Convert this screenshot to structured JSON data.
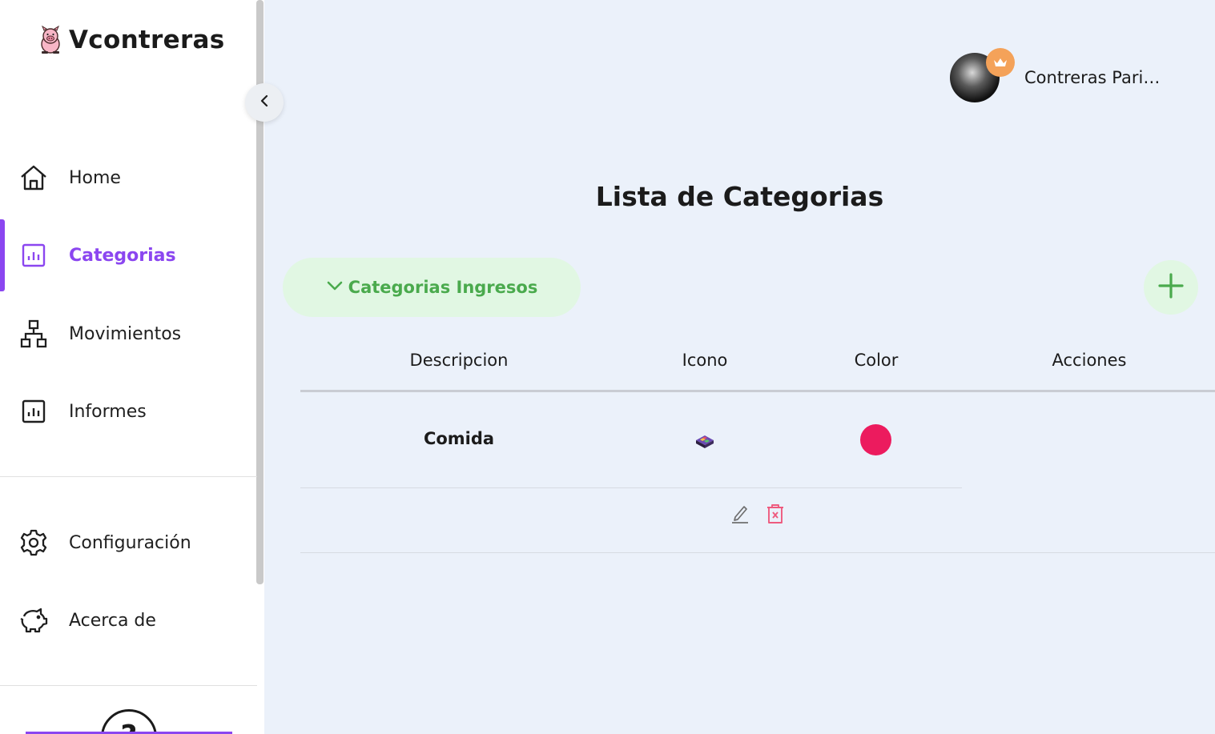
{
  "brand": {
    "name": "Vcontreras",
    "logo_icon": "pig-icon"
  },
  "sidebar": {
    "collapse_icon": "chevron-left-icon",
    "items": [
      {
        "label": "Home",
        "icon": "home-icon",
        "active": false
      },
      {
        "label": "Categorias",
        "icon": "chart-icon",
        "active": true
      },
      {
        "label": "Movimientos",
        "icon": "hierarchy-icon",
        "active": false
      },
      {
        "label": "Informes",
        "icon": "report-icon",
        "active": false
      },
      {
        "label": "Configuración",
        "icon": "gear-icon",
        "active": false
      },
      {
        "label": "Acerca de",
        "icon": "piggy-bank-icon",
        "active": false
      }
    ],
    "help_glyph": "?"
  },
  "user": {
    "name": "Contreras Pari…",
    "badge_icon": "crown-icon"
  },
  "main": {
    "title": "Lista de Categorias",
    "section": {
      "label": "Categorias Ingresos",
      "icon": "chevron-down-icon",
      "expanded": true
    },
    "add_icon": "plus-icon",
    "table": {
      "headers": [
        "Descripcion",
        "Icono",
        "Color",
        "Acciones"
      ],
      "rows": [
        {
          "descripcion": "Comida",
          "icono": "bento-box-icon",
          "color": "#ec1b5e"
        }
      ],
      "actions": [
        {
          "icon": "edit-icon"
        },
        {
          "icon": "delete-icon"
        }
      ]
    }
  },
  "colors": {
    "accent": "#8b46f0",
    "success": "#4aaa4d",
    "success_bg": "#e1f7e3",
    "danger": "#ee5a7e",
    "background": "#ebf1fa"
  }
}
